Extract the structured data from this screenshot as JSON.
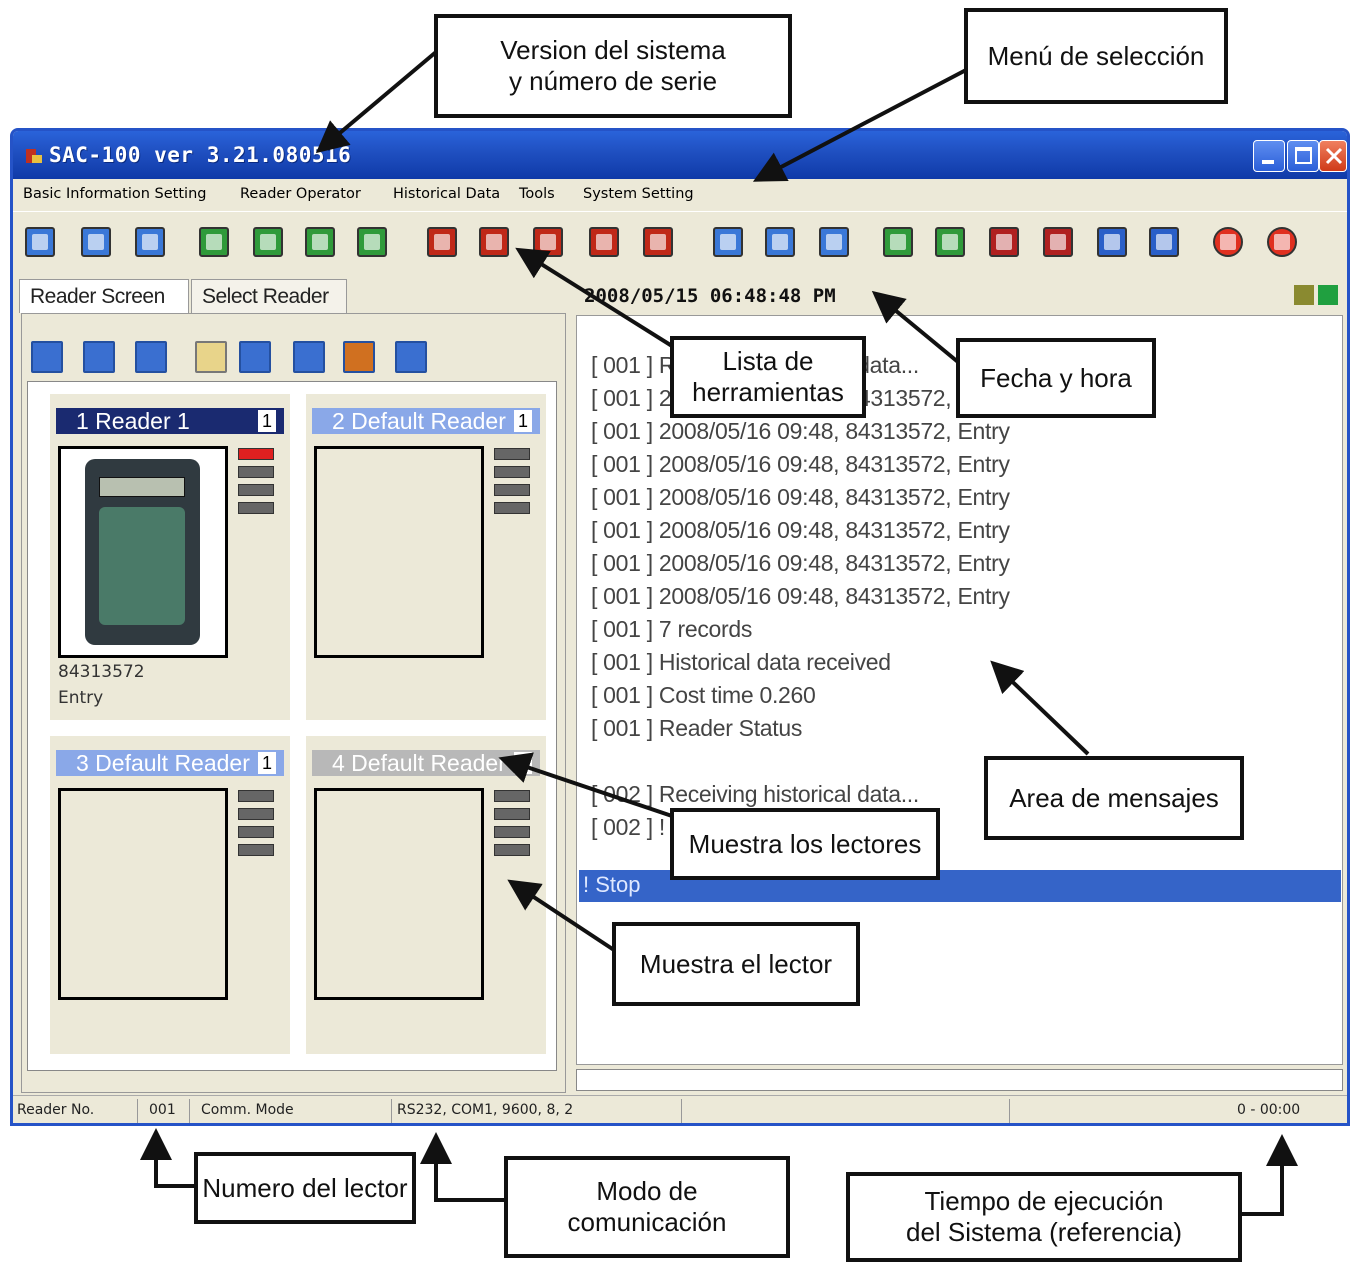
{
  "window": {
    "title": "SAC-100 ver 3.21.080516",
    "accent": "#2553c7"
  },
  "menu": [
    "Basic Information Setting",
    "Reader Operator",
    "Historical Data",
    "Tools",
    "System Setting"
  ],
  "toolbar_icons": [
    "connect-icon",
    "disconnect-icon",
    "read-icon",
    "r1-icon",
    "r2-icon",
    "r3-icon",
    "r4-icon",
    "red1-icon",
    "red2-icon",
    "red3-icon",
    "red4-icon",
    "red5-icon",
    "blue1-icon",
    "blue2-icon",
    "blue3-icon",
    "green1-icon",
    "green2-icon",
    "red6-icon",
    "red7-icon",
    "blue4-icon",
    "blue5-icon",
    "stop-icon",
    "exit-icon"
  ],
  "tabs": [
    "Reader Screen",
    "Select Reader"
  ],
  "datetime": "2008/05/15 06:48:48 PM",
  "readers": [
    {
      "title": "1  Reader 1",
      "num": "1",
      "card": "84313572",
      "status": "Entry"
    },
    {
      "title": "2  Default Reader",
      "num": "1",
      "card": "",
      "status": ""
    },
    {
      "title": "3  Default Reader",
      "num": "1",
      "card": "",
      "status": ""
    },
    {
      "title": "4  Default Reader",
      "num": "1",
      "card": "",
      "status": ""
    }
  ],
  "messages": [
    "[ 001 ] Receiving historical data...",
    "[ 001 ] 2008/05/16 09:48, 84313572, Entry",
    "[ 001 ] 2008/05/16 09:48, 84313572, Entry",
    "[ 001 ] 2008/05/16 09:48, 84313572, Entry",
    "[ 001 ] 2008/05/16 09:48, 84313572, Entry",
    "[ 001 ] 2008/05/16 09:48, 84313572, Entry",
    "[ 001 ] 2008/05/16 09:48, 84313572, Entry",
    "[ 001 ] 2008/05/16 09:48, 84313572, Entry",
    "[ 001 ] 7 records",
    "[ 001 ] Historical data received",
    "[ 001 ] Cost time 0.260",
    "[ 001 ] Reader Status",
    "",
    "[ 002 ] Receiving historical data...",
    "[ 002 ] ! Stop"
  ],
  "stop_message": "! Stop",
  "status": {
    "reader_label": "Reader No.",
    "reader_value": "001",
    "comm_label": "Comm. Mode",
    "comm_value": "RS232, COM1, 9600, 8, 2",
    "elapsed": "0 - 00:00"
  },
  "callouts": {
    "version": "Version del sistema\ny número de serie",
    "menu": "Menú de selección",
    "tools": "Lista de\nherramientas",
    "datetime": "Fecha y hora",
    "messages": "Area de mensajes",
    "readers": "Muestra los lectores",
    "reader": "Muestra el lector",
    "reader_no": "Numero del lector",
    "comm_mode": "Modo de\ncomunicación",
    "runtime": "Tiempo de ejecución\ndel Sistema (referencia)"
  }
}
